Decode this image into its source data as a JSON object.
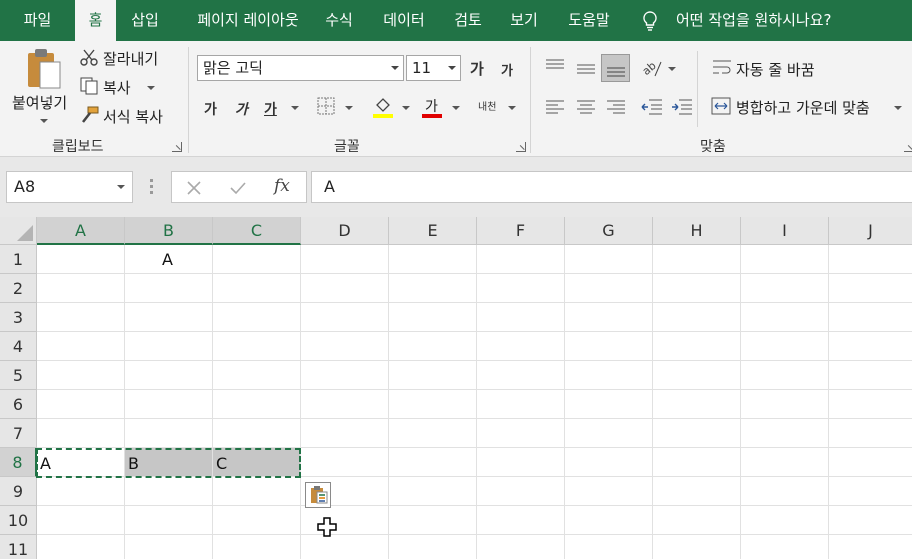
{
  "tabs": [
    {
      "label": "파일",
      "active": false
    },
    {
      "label": "홈",
      "active": true
    },
    {
      "label": "삽입",
      "active": false
    },
    {
      "label": "페이지 레이아웃",
      "active": false
    },
    {
      "label": "수식",
      "active": false
    },
    {
      "label": "데이터",
      "active": false
    },
    {
      "label": "검토",
      "active": false
    },
    {
      "label": "보기",
      "active": false
    },
    {
      "label": "도움말",
      "active": false
    }
  ],
  "tell_me": "어떤 작업을 원하시나요?",
  "clipboard": {
    "paste": "붙여넣기",
    "cut": "잘라내기",
    "copy": "복사",
    "format_painter": "서식 복사",
    "group_label": "클립보드"
  },
  "font": {
    "name": "맑은 고딕",
    "size": "11",
    "grow": "가",
    "shrink": "가",
    "bold": "가",
    "italic": "가",
    "underline": "가",
    "font_color": "가",
    "phonetic": "내천",
    "group_label": "글꼴",
    "fill_color": "#ffff00",
    "text_color": "#e00000"
  },
  "alignment": {
    "wrap_text": "자동 줄 바꿈",
    "merge_center": "병합하고 가운데 맞춤",
    "group_label": "맞춤"
  },
  "formula_bar": {
    "name_box": "A8",
    "fx": "fx",
    "value": "A"
  },
  "sheet": {
    "columns": [
      "A",
      "B",
      "C",
      "D",
      "E",
      "F",
      "G",
      "H",
      "I",
      "J"
    ],
    "rows": [
      "1",
      "2",
      "3",
      "4",
      "5",
      "6",
      "7",
      "8",
      "9",
      "10",
      "11"
    ],
    "selected_columns": [
      "A",
      "B",
      "C"
    ],
    "selected_row": "8",
    "cells": {
      "B1": "A",
      "A8": "A",
      "B8": "B",
      "C8": "C"
    }
  },
  "colors": {
    "accent": "#217346"
  }
}
